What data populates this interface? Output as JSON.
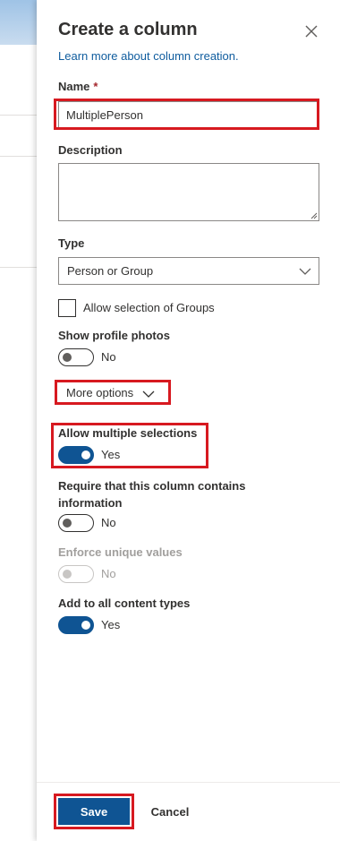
{
  "panel": {
    "title": "Create a column",
    "learn_more_link": "Learn more about column creation."
  },
  "fields": {
    "name_label": "Name",
    "name_required_mark": "*",
    "name_value": "MultiplePerson",
    "description_label": "Description",
    "description_value": "",
    "type_label": "Type",
    "type_value": "Person or Group",
    "allow_groups_label": "Allow selection of Groups",
    "allow_groups_checked": false
  },
  "toggles": {
    "show_profile_photos": {
      "label": "Show profile photos",
      "state_text": "No",
      "on": false
    },
    "allow_multiple_selections": {
      "label": "Allow multiple selections",
      "state_text": "Yes",
      "on": true
    },
    "require_info": {
      "label": "Require that this column contains information",
      "state_text": "No",
      "on": false
    },
    "enforce_unique": {
      "label": "Enforce unique values",
      "state_text": "No",
      "on": false,
      "disabled": true
    },
    "add_to_content_types": {
      "label": "Add to all content types",
      "state_text": "Yes",
      "on": true
    }
  },
  "more_options_label": "More options",
  "footer": {
    "save_label": "Save",
    "cancel_label": "Cancel"
  },
  "icons": {
    "close": "close-icon",
    "dropdown": "chevron-down-icon",
    "more_options": "chevron-down-icon"
  },
  "colors": {
    "accent": "#0f5493",
    "link": "#0f5c9e",
    "highlight": "#d71920",
    "required": "#a4262c"
  }
}
